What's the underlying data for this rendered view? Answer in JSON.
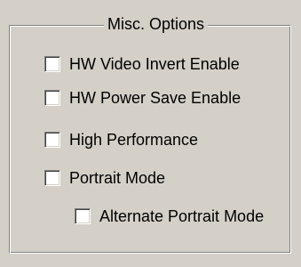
{
  "group": {
    "title": "Misc. Options"
  },
  "options": [
    {
      "label": "HW Video Invert Enable",
      "checked": false
    },
    {
      "label": "HW Power Save Enable",
      "checked": false
    },
    {
      "label": "High Performance",
      "checked": false
    },
    {
      "label": "Portrait Mode",
      "checked": false
    },
    {
      "label": "Alternate Portrait Mode",
      "checked": false
    }
  ],
  "colors": {
    "panel_bg": "#d4d0c8",
    "checkbox_bg": "#ffffff",
    "shadow": "#808080",
    "highlight": "#ffffff"
  }
}
